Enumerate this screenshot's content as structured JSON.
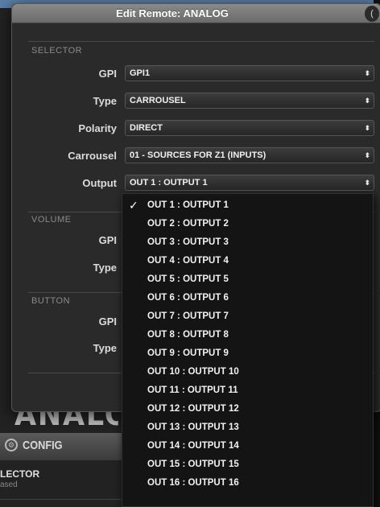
{
  "dialog": {
    "title": "Edit Remote: ANALOG",
    "corner_glyph": "("
  },
  "selector": {
    "title": "SELECTOR",
    "fields": [
      {
        "label": "GPI",
        "value": "GPI1"
      },
      {
        "label": "Type",
        "value": "CARROUSEL"
      },
      {
        "label": "Polarity",
        "value": "DIRECT"
      },
      {
        "label": "Carrousel",
        "value": "01 - SOURCES FOR Z1 (INPUTS)"
      },
      {
        "label": "Output",
        "value": "OUT 1 : OUTPUT 1"
      }
    ]
  },
  "volume": {
    "title": "VOLUME",
    "fields": [
      {
        "label": "GPI"
      },
      {
        "label": "Type"
      }
    ]
  },
  "button": {
    "title": "BUTTON",
    "fields": [
      {
        "label": "GPI"
      },
      {
        "label": "Type"
      }
    ]
  },
  "select_arrows": "⬍",
  "dropdown": {
    "check_glyph": "✓",
    "selected_index": 0,
    "options": [
      "OUT 1 : OUTPUT 1",
      "OUT 2 : OUTPUT 2",
      "OUT 3 : OUTPUT 3",
      "OUT 4 : OUTPUT 4",
      "OUT 5 : OUTPUT 5",
      "OUT 6 : OUTPUT 6",
      "OUT 7 : OUTPUT 7",
      "OUT 8 : OUTPUT 8",
      "OUT 9 : OUTPUT 9",
      "OUT 10 : OUTPUT 10",
      "OUT 11 : OUTPUT 11",
      "OUT 12 : OUTPUT 12",
      "OUT 13 : OUTPUT 13",
      "OUT 14 : OUTPUT 14",
      "OUT 15 : OUTPUT 15",
      "OUT 16 : OUTPUT 16"
    ]
  },
  "background_app": {
    "logo_text": "ANALOG",
    "config_label": "CONFIG",
    "selector_label": "LECTOR",
    "selector_sub": "ased"
  }
}
